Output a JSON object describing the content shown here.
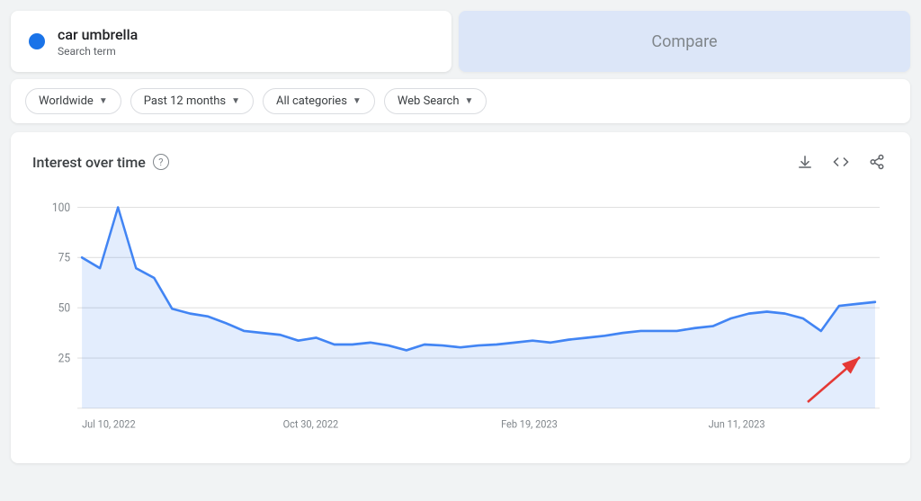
{
  "searchTerm": {
    "name": "car umbrella",
    "label": "Search term",
    "dotColor": "#1a73e8"
  },
  "compare": {
    "label": "Compare"
  },
  "filters": [
    {
      "id": "region",
      "label": "Worldwide"
    },
    {
      "id": "timerange",
      "label": "Past 12 months"
    },
    {
      "id": "category",
      "label": "All categories"
    },
    {
      "id": "searchtype",
      "label": "Web Search"
    }
  ],
  "chart": {
    "title": "Interest over time",
    "helpLabel": "?",
    "downloadLabel": "⬇",
    "embedLabel": "<>",
    "shareLabel": "share",
    "yAxisLabels": [
      "100",
      "75",
      "50",
      "25"
    ],
    "xAxisLabels": [
      "Jul 10, 2022",
      "Oct 30, 2022",
      "Feb 19, 2023",
      "Jun 11, 2023"
    ]
  }
}
